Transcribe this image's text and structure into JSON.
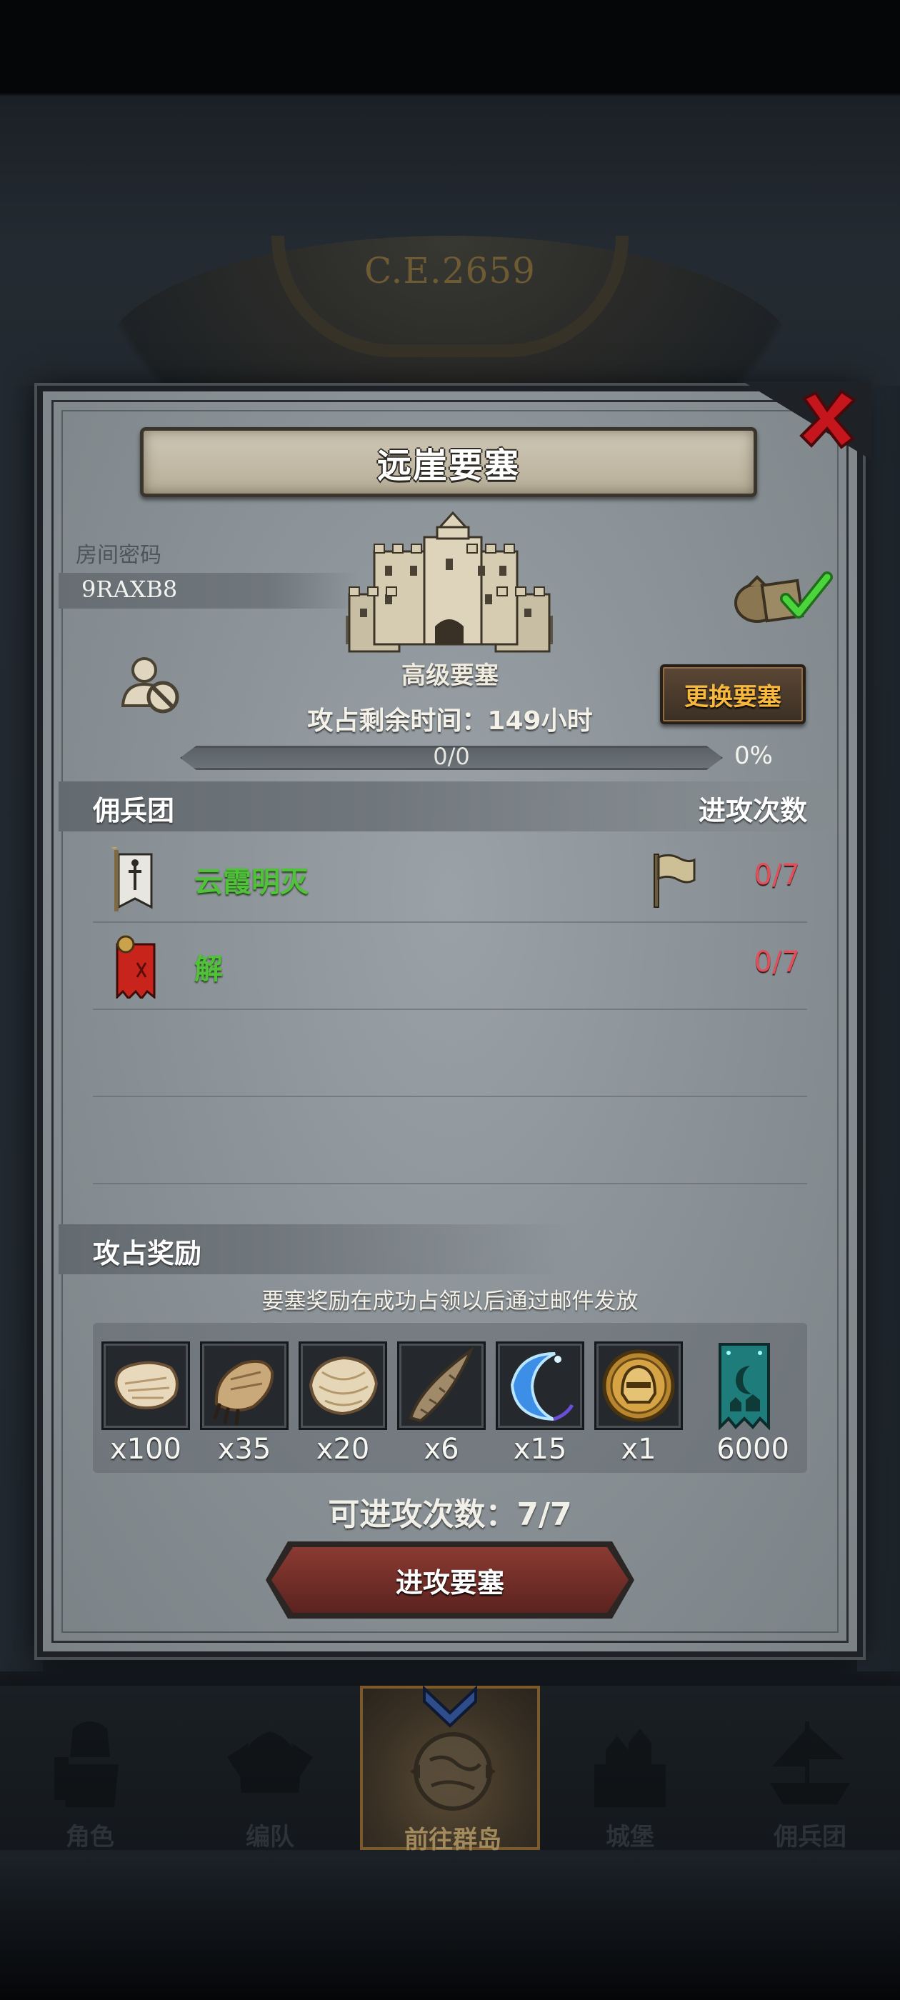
{
  "background": {
    "year": "C.E.2659"
  },
  "dialog": {
    "title": "远崖要塞",
    "room_label": "房间密码",
    "room_code": "9RAXB8",
    "fortress_level": "高级要塞",
    "change_button": "更换要塞",
    "timer": "攻占剩余时间：149小时",
    "progress_text": "0/0",
    "progress_percent": "0%",
    "progress_fraction": 0,
    "mercenary_header": "佣兵团",
    "attack_count_header": "进攻次数",
    "mercenaries": [
      {
        "name": "云霞明灭",
        "count": "0/7",
        "has_flag": true
      },
      {
        "name": "解",
        "count": "0/7",
        "has_flag": false
      }
    ],
    "reward_header": "攻占奖励",
    "reward_note": "要塞奖励在成功占领以后通过邮件发放",
    "rewards": [
      {
        "icon": "hide-icon",
        "qty": "x100"
      },
      {
        "icon": "claw-icon",
        "qty": "x35"
      },
      {
        "icon": "fur-icon",
        "qty": "x20"
      },
      {
        "icon": "horn-icon",
        "qty": "x6"
      },
      {
        "icon": "crescent-icon",
        "qty": "x15"
      },
      {
        "icon": "helmet-medal-icon",
        "qty": "x1"
      },
      {
        "icon": "guild-banner-icon",
        "qty": "6000"
      }
    ],
    "attacks_available": "可进攻次数：7/7",
    "attack_button": "进攻要塞"
  },
  "nav": {
    "items": [
      {
        "label": "角色",
        "icon": "knight-icon"
      },
      {
        "label": "编队",
        "icon": "helmet-icon"
      },
      {
        "label": "前往群岛",
        "icon": "globe-icon",
        "active": true
      },
      {
        "label": "城堡",
        "icon": "castle-icon"
      },
      {
        "label": "佣兵团",
        "icon": "ship-icon"
      }
    ]
  },
  "colors": {
    "green_name": "#4fc23a",
    "red_count": "#e0505a",
    "gold_button_text": "#f8b83b",
    "attack_button": "#8a3a32"
  }
}
